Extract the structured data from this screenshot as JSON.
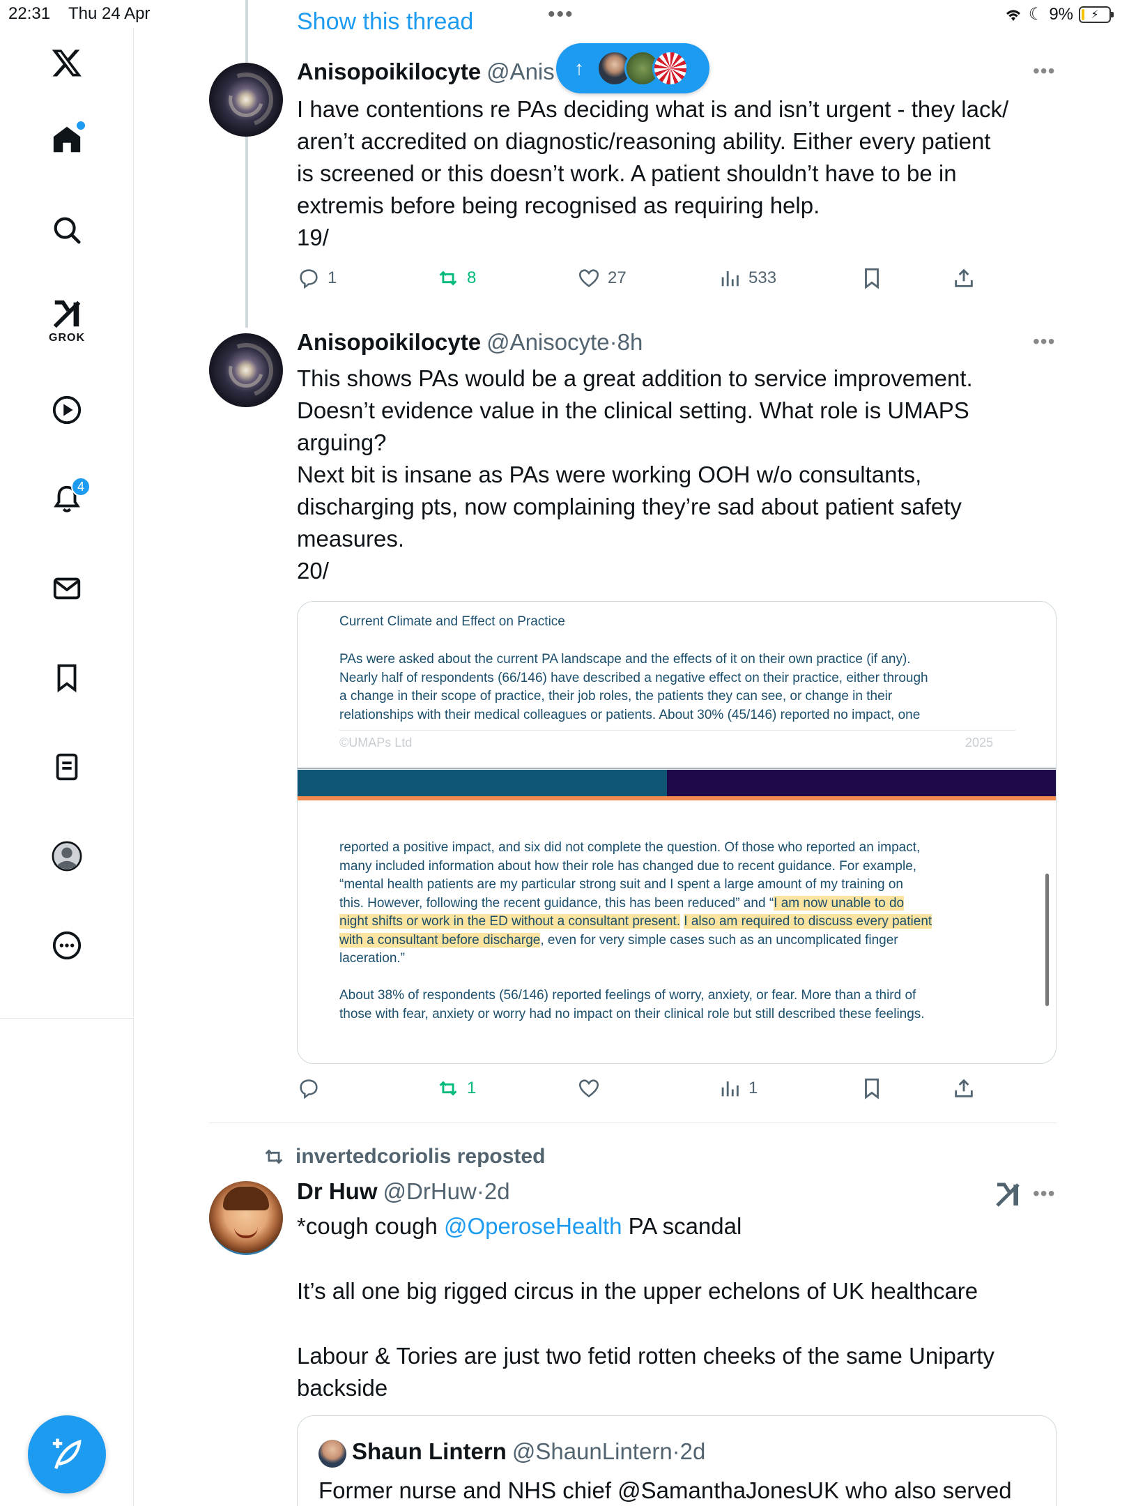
{
  "status_bar": {
    "time": "22:31",
    "date": "Thu 24 Apr",
    "battery": "9%"
  },
  "sidebar": {
    "grok_label": "GROK",
    "notifications_count": "4"
  },
  "thread": {
    "show_thread_label": "Show this thread"
  },
  "tweets": [
    {
      "name": "Anisopoikilocyte",
      "handle": "@Anis",
      "lines": [
        "I have contentions re PAs deciding what is and isn’t urgent - they lack/",
        "aren’t accredited on diagnostic/reasoning ability. Either every patient",
        "is screened or this doesn’t work. A patient shouldn’t have to be in",
        "extremis before being recognised as requiring help.",
        "19/"
      ],
      "replies": "1",
      "reposts": "8",
      "likes": "27",
      "views": "533"
    },
    {
      "name": "Anisopoikilocyte",
      "handle": "@Anisocyte",
      "time": "8h",
      "lines": [
        "This shows PAs would be a great addition to service improvement.",
        "Doesn’t evidence value in the clinical setting. What role is UMAPS",
        "arguing?",
        "Next bit is insane as PAs were working OOH w/o consultants,",
        "discharging pts, now complaining they’re sad about patient safety",
        "measures.",
        "20/"
      ],
      "replies": "",
      "reposts": "1",
      "likes": "",
      "views": "1"
    },
    {
      "repost_by": "invertedcoriolis reposted",
      "name": "Dr Huw",
      "handle": "@DrHuw",
      "time": "2d",
      "line1_prefix": "*cough cough ",
      "line1_mention": "@OperoseHealth",
      "line1_suffix": " PA scandal",
      "line2": "It’s all one big rigged circus in the upper echelons of UK healthcare",
      "line3a": "Labour & Tories are just two fetid rotten cheeks of the same Uniparty",
      "line3b": "backside"
    }
  ],
  "document_image": {
    "heading": "Current Climate and Effect on Practice",
    "para1": [
      "PAs were asked about the current PA landscape and the effects of it on their own practice (if any).",
      "Nearly half of respondents (66/146) have described a negative effect on their practice, either through",
      "a change in their scope of practice, their job roles, the patients they can see, or change in their",
      "relationships with their medical colleagues or patients. About 30% (45/146) reported no impact, one"
    ],
    "footer_left": "©UMAPs Ltd",
    "footer_right": "2025",
    "para2": {
      "l1": "reported a positive impact, and six did not complete the question. Of those who reported an impact,",
      "l2": "many included information about how their role has changed due to recent guidance. For example,",
      "l3": "“mental health patients are my particular strong suit and I spent a large amount of my training on",
      "l4_a": "this. However, following the recent guidance, this has been reduced” and “",
      "l4_hl": "I am now unable to do",
      "l5_hl": "night shifts or work in the ED without a consultant present.",
      "l5_sp": " ",
      "l5_hl2": "I also am required to discuss every patient",
      "l6_hl": "with a consultant before discharge",
      "l6_b": ", even for very simple cases such as an uncomplicated finger",
      "l7": "laceration.”"
    },
    "para3": [
      "About 38% of respondents (56/146) reported feelings of worry, anxiety, or fear. More than a third of",
      "those with fear, anxiety or worry had no impact on their clinical role but still described these feelings."
    ]
  },
  "quote": {
    "name": "Shaun Lintern",
    "handle": "@ShaunLintern",
    "time": "2d",
    "text": "Former nurse and NHS chief @SamanthaJonesUK who also served"
  },
  "colors": {
    "accent": "#1d9bf0",
    "repost_green": "#00ba7c",
    "doc_text": "#1b4f6c",
    "highlight": "#fbe3a0"
  }
}
